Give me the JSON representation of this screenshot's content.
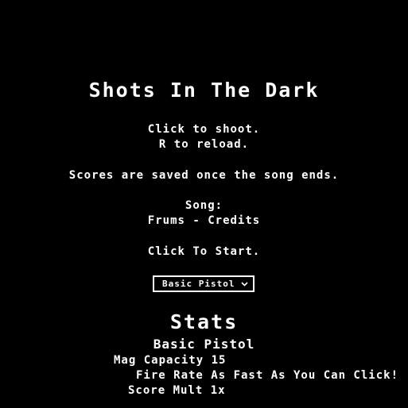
{
  "title": "Shots In The Dark",
  "instructions": {
    "shoot": "Click to shoot.",
    "reload": "R to reload.",
    "scores": "Scores are saved once the song ends."
  },
  "song": {
    "label": "Song:",
    "name": "Frums - Credits"
  },
  "start_prompt": "Click To Start.",
  "weapon_select": {
    "selected": "Basic Pistol"
  },
  "stats": {
    "heading": "Stats",
    "weapon_name": "Basic Pistol",
    "mag_capacity": "Mag Capacity 15",
    "fire_rate": "Fire Rate As Fast As You Can Click!",
    "score_mult": "Score Mult 1x"
  },
  "colors": {
    "background": "#000000",
    "text": "#ffffff"
  }
}
